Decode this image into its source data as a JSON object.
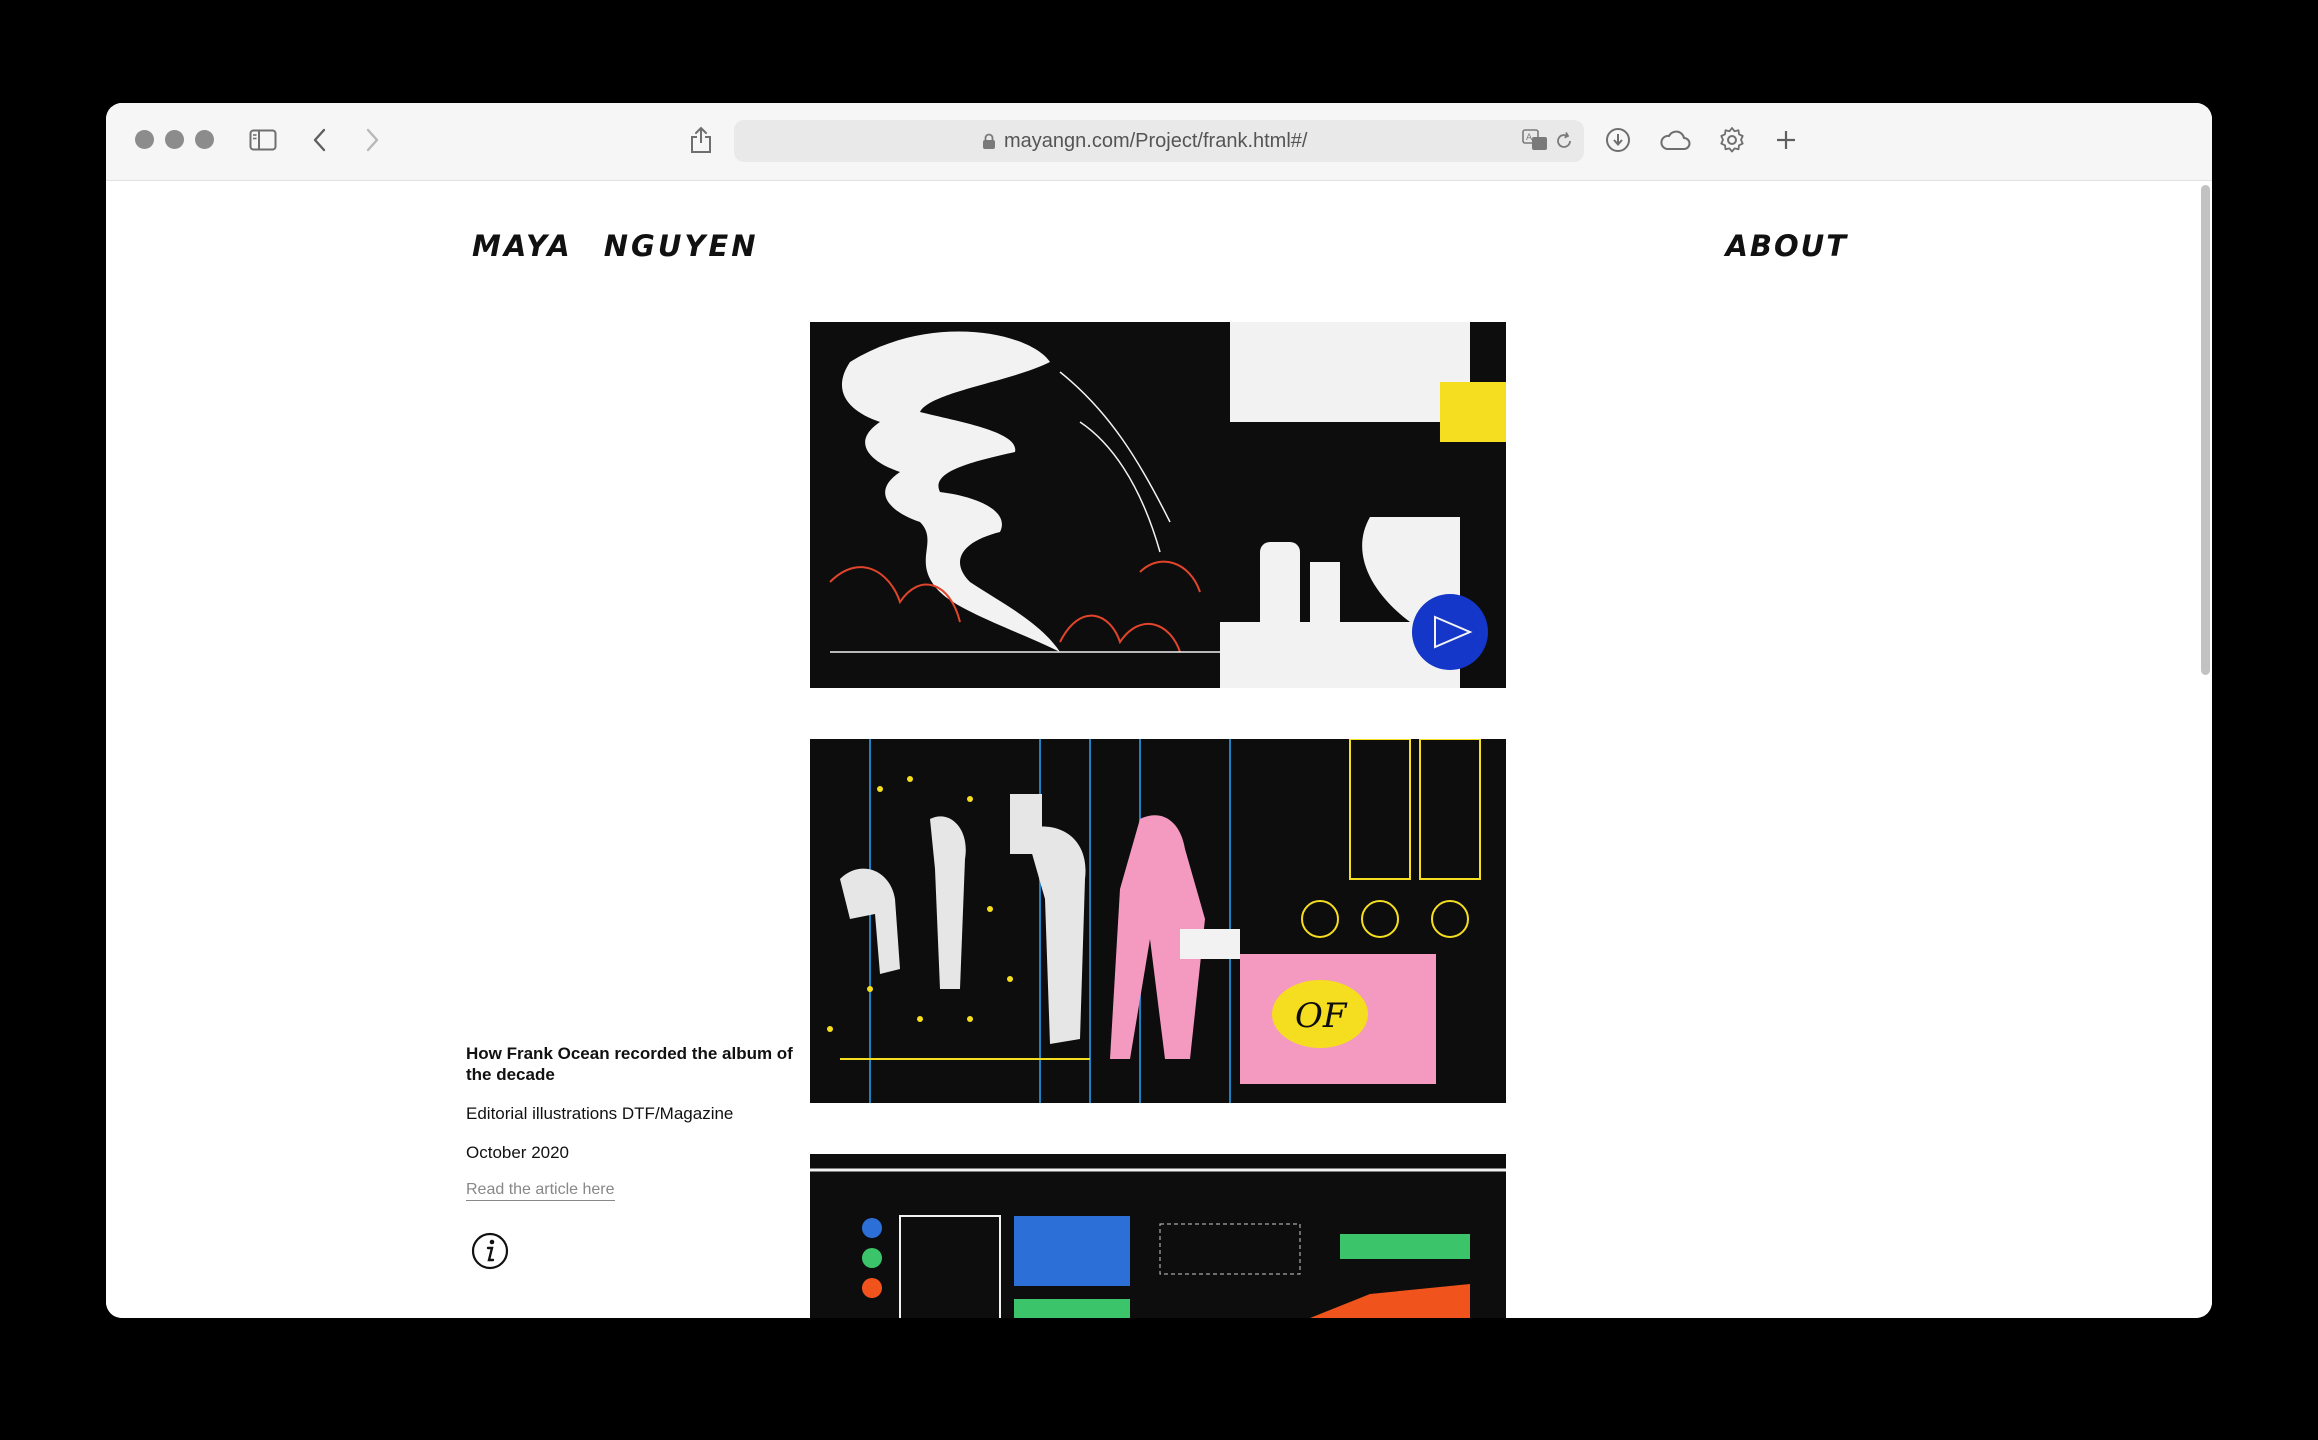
{
  "browser": {
    "url": "mayangn.com/Project/frank.html#/"
  },
  "site": {
    "logo_first": "MAYA",
    "logo_last": "NGUYEN",
    "nav_about": "ABOUT"
  },
  "project": {
    "title": "How Frank Ocean recorded the album of the decade",
    "subtitle": "Editorial illustrations DTF/Magazine",
    "date": "October 2020",
    "link_label": "Read the article here"
  },
  "illustrations": [
    {
      "name": "illustration-1",
      "colors": [
        "#0d0d0d",
        "#f2f2f2",
        "#e0452b",
        "#1436c9",
        "#f5dd1f"
      ]
    },
    {
      "name": "illustration-2",
      "colors": [
        "#0d0d0d",
        "#e6e6e6",
        "#f49ac1",
        "#f5dd1f",
        "#1f7fc2"
      ]
    },
    {
      "name": "illustration-3",
      "colors": [
        "#0d0d0d",
        "#2c6fd6",
        "#3cc46b",
        "#f0541c"
      ]
    }
  ],
  "icons": [
    "sidebar-icon",
    "back-icon",
    "forward-icon",
    "share-icon",
    "lock-icon",
    "translate-icon",
    "reload-icon",
    "download-icon",
    "cloud-icon",
    "settings-icon",
    "new-tab-icon",
    "info-icon"
  ]
}
